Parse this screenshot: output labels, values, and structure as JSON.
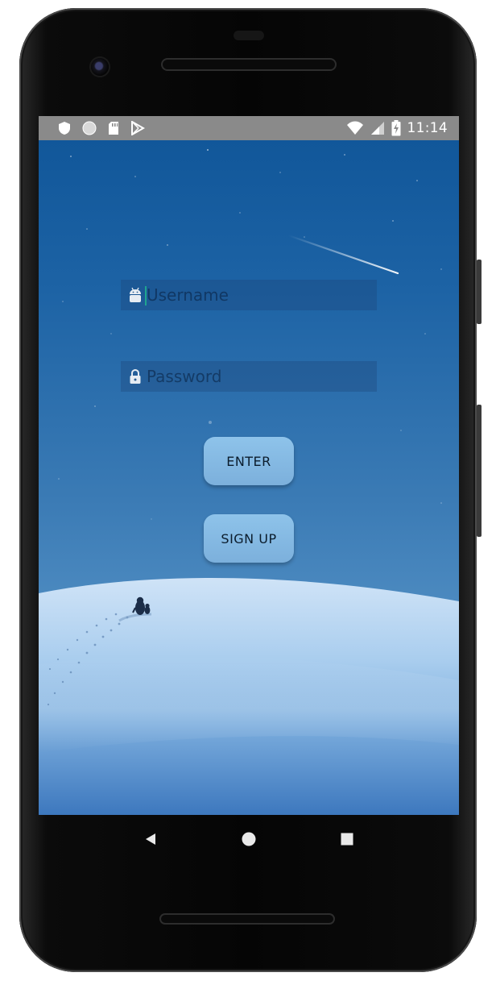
{
  "status_bar": {
    "time": "11:14",
    "left_icons": [
      "shield-icon",
      "circle-icon",
      "sd-card-icon",
      "play-store-icon"
    ],
    "right_icons": [
      "wifi-icon",
      "signal-icon",
      "battery-charging-icon"
    ]
  },
  "login_form": {
    "username": {
      "placeholder": "Username",
      "value": "",
      "icon": "android-icon"
    },
    "password": {
      "placeholder": "Password",
      "value": "",
      "icon": "lock-icon"
    }
  },
  "buttons": {
    "enter_label": "ENTER",
    "signup_label": "SIGN UP"
  },
  "navigation_bar": {
    "items": [
      "back-icon",
      "home-icon",
      "recents-icon"
    ]
  },
  "colors": {
    "sky_top": "#0f5598",
    "sky_bottom": "#6a9fd0",
    "button": "#86bae3",
    "status_bar": "#8a8a8a",
    "cursor": "#1fa58f"
  }
}
